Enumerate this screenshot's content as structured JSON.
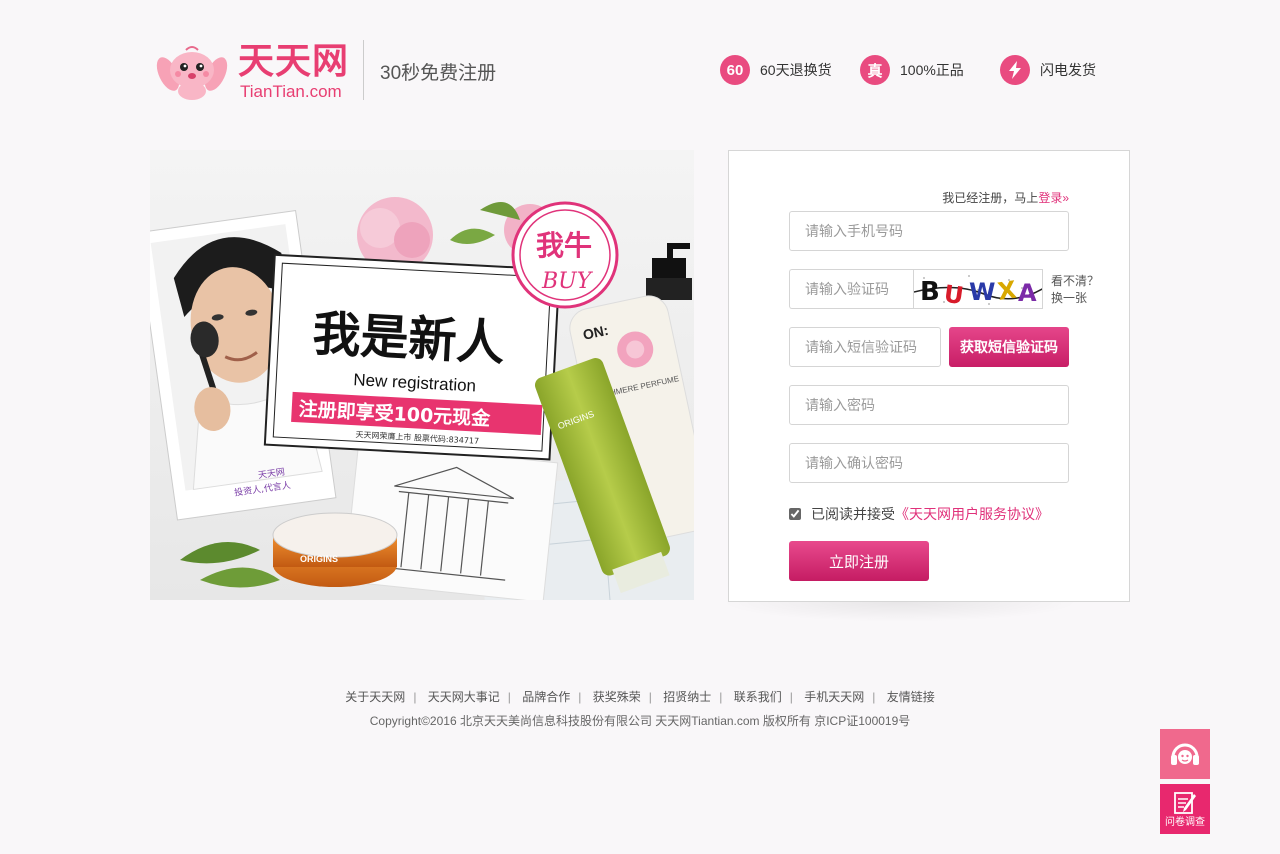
{
  "header": {
    "logo_cn": "天天网",
    "logo_en": "TianTian.com",
    "slogan": "30秒免费注册",
    "promises": [
      {
        "badge": "60",
        "text": "60天退换货",
        "icon": "sixty-badge-icon"
      },
      {
        "badge": "真",
        "text": "100%正品",
        "icon": "authentic-badge-icon"
      },
      {
        "badge": "",
        "text": "闪电发货",
        "icon": "lightning-icon"
      }
    ]
  },
  "banner": {
    "headline": "我是新人",
    "subhead": "New registration",
    "offer": "注册即享受100元现金",
    "stock": "天天网荣膺上市 股票代码:834717",
    "stamp_cn": "我牛",
    "stamp_en": "BUY",
    "person_caption_1": "天天网",
    "person_caption_2": "投资人,代言人",
    "bottle_brand": "ON:",
    "bottle_label": "CASHMERE PERFUME",
    "tube_brand": "ORIGINS",
    "jar_brand": "ORIGINS"
  },
  "form": {
    "login_hint": "我已经注册，马上",
    "login_link": "登录»",
    "phone_placeholder": "请输入手机号码",
    "captcha_placeholder": "请输入验证码",
    "captcha_text": "BUWXA",
    "refresh_line1": "看不清？",
    "refresh_line2": "换一张",
    "sms_placeholder": "请输入短信验证码",
    "sms_button": "获取短信验证码",
    "password_placeholder": "请输入密码",
    "confirm_placeholder": "请输入确认密码",
    "agree_text": "已阅读并接受",
    "agree_link": "《天天网用户服务协议》",
    "agree_checked": true,
    "register_button": "立即注册"
  },
  "footer": {
    "links": [
      "关于天天网",
      "天天网大事记",
      "品牌合作",
      "获奖殊荣",
      "招贤纳士",
      "联系我们",
      "手机天天网",
      "友情链接"
    ],
    "copyright": "Copyright©2016 北京天天美尚信息科技股份有限公司 天天网Tiantian.com 版权所有 京ICP证100019号"
  },
  "side": {
    "service_icon": "customer-service-icon",
    "survey_icon": "survey-icon",
    "survey_label": "问卷调查"
  },
  "colors": {
    "brand_pink": "#e83e72",
    "button_pink": "#d12b70",
    "link_pink": "#e0317a"
  }
}
